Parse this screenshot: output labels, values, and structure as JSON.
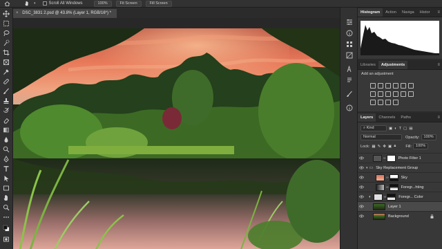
{
  "options_bar": {
    "scroll_all_windows": "Scroll All Windows",
    "zoom": "100%",
    "fit_screen": "Fit Screen",
    "fill_screen": "Fill Screen"
  },
  "document": {
    "tab_title": "DSC_3831 2.psd @ 43.8% (Layer 1, RGB/16*) *"
  },
  "panels": {
    "top_tabs": [
      "Histogram",
      "Action",
      "Naviga",
      "Histor"
    ],
    "mid_tabs": [
      "Libraries",
      "Adjustments"
    ],
    "add_adjustment": "Add an adjustment",
    "layer_tabs": [
      "Layers",
      "Channels",
      "Paths"
    ]
  },
  "layers_panel": {
    "filter_kind": "Kind",
    "blend_mode": "Normal",
    "opacity_label": "Opacity:",
    "opacity_value": "100%",
    "lock_label": "Lock:",
    "fill_label": "Fill:",
    "fill_value": "100%",
    "layers": [
      {
        "name": "Photo Filter 1"
      },
      {
        "name": "Sky Replacement Group"
      },
      {
        "name": "Sky"
      },
      {
        "name": "Foregr...hting"
      },
      {
        "name": "Foregr... Color"
      },
      {
        "name": "Layer 1"
      },
      {
        "name": "Background"
      }
    ]
  },
  "colors": {
    "panel_bg": "#383838",
    "app_bg": "#262626",
    "selected_layer": "#4a4a4a",
    "sky_accent": "#e06a4e"
  }
}
